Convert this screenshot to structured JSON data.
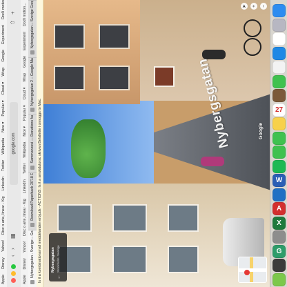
{
  "browser": {
    "menu_items": [
      "Apple",
      "Disney",
      "Yahoo!",
      "Disc o arte, linear - Kig",
      "Linkedin",
      "Twitter",
      "Wikipedia",
      "Nice ▾",
      "Popular ▾",
      "Cloud ▾",
      "Wrap",
      "Google",
      "Experiment",
      "Dod'i motion...",
      "aww",
      "amrew",
      "Vaste Portal"
    ],
    "url": "google.com",
    "favorites": [
      "Apple",
      "Disney",
      "Yahoo!",
      "Disc o arte, linear - Kig",
      "LinkedIn",
      "Twitter",
      "Wikipedia",
      "Nice ▾",
      "Popular ▾",
      "Cloud ▾",
      "Wrap",
      "Google",
      "Experiment",
      "Dod'i motion...",
      "Free Kinrit..."
    ],
    "tabs": [
      {
        "label": "Nybergsgatan - Sverige – Google Maps"
      },
      {
        "label": "Download Paperback 20'18 Disbanfo..."
      },
      {
        "label": "Sammanossi — Donations fur Urlau..."
      },
      {
        "label": "Nybergsgatan 2 – Google Maps"
      },
      {
        "label": "Nybergsgatan – Sverige Google"
      }
    ],
    "infobar_text": "Is it a kombinationsmall meddelanden erbjuds - ACTIONS: Is it a smokdutorsc skrivan Befallette i onnoggs to Mac."
  },
  "streetview": {
    "address_title": "Nybergsgatan",
    "address_sub": "Stockholm, Sverige",
    "street_label": "Nybergsgatan",
    "google_logo": "Google"
  },
  "dock": {
    "apps": [
      {
        "name": "finder",
        "color": "#2d8cf0",
        "glyph": ""
      },
      {
        "name": "launchpad",
        "color": "#b7b7c2",
        "glyph": ""
      },
      {
        "name": "chrome",
        "color": "#ffffff",
        "glyph": ""
      },
      {
        "name": "safari",
        "color": "#1e88e5",
        "glyph": ""
      },
      {
        "name": "photos",
        "color": "#f3f3f3",
        "glyph": ""
      },
      {
        "name": "messages",
        "color": "#3fc14f",
        "glyph": ""
      },
      {
        "name": "contacts",
        "color": "#7b5a3a",
        "glyph": ""
      },
      {
        "name": "calendar",
        "color": "#ffffff",
        "glyph": "27"
      },
      {
        "name": "notes",
        "color": "#f7d14b",
        "glyph": ""
      },
      {
        "name": "whatsapp",
        "color": "#3fc14f",
        "glyph": ""
      },
      {
        "name": "facetime",
        "color": "#3fc14f",
        "glyph": ""
      },
      {
        "name": "spotify",
        "color": "#1db954",
        "glyph": ""
      },
      {
        "name": "word",
        "color": "#2b5fb5",
        "glyph": "W"
      },
      {
        "name": "outlook",
        "color": "#1f6fc4",
        "glyph": ""
      },
      {
        "name": "acrobat",
        "color": "#d32f2f",
        "glyph": "A"
      },
      {
        "name": "excel",
        "color": "#1f7a3e",
        "glyph": "X"
      },
      {
        "name": "keynote",
        "color": "#8d8d8d",
        "glyph": ""
      },
      {
        "name": "grammarly",
        "color": "#2e9c6a",
        "glyph": "G"
      },
      {
        "name": "camera",
        "color": "#3b3b3b",
        "glyph": ""
      },
      {
        "name": "green-app",
        "color": "#7cc84b",
        "glyph": ""
      }
    ]
  }
}
